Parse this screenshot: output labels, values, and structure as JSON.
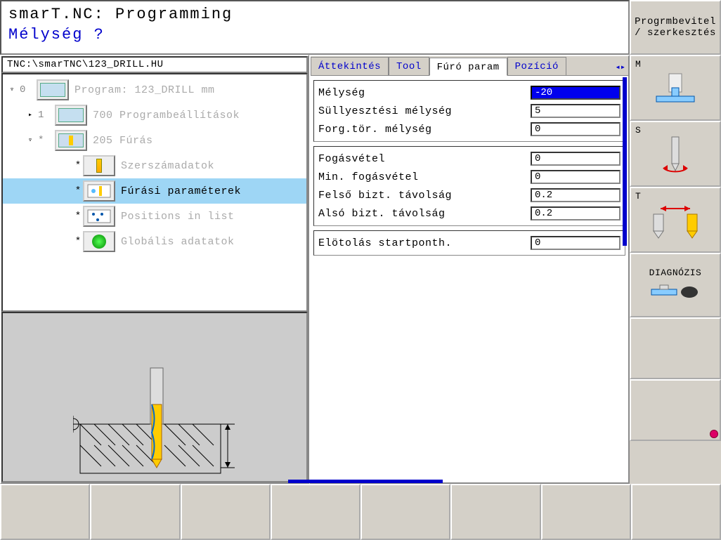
{
  "header": {
    "title": "smarT.NC: Programming",
    "prompt": "Mélység ?"
  },
  "rail_header": {
    "line1": "Progrmbevitel",
    "line2": "/ szerkesztés"
  },
  "path": "TNC:\\smarTNC\\123_DRILL.HU",
  "tree": {
    "items": [
      {
        "index": "0",
        "expander": "▿",
        "label": "Program: 123_DRILL mm",
        "dim": true,
        "indent": 0,
        "bullet": ""
      },
      {
        "index": "1",
        "expander": "▸",
        "label": "700 Programbeállítások",
        "dim": true,
        "indent": 1,
        "bullet": ""
      },
      {
        "index": "*",
        "expander": "▿",
        "label": "205 Fúrás",
        "dim": true,
        "indent": 1,
        "bullet": ""
      },
      {
        "index": "",
        "expander": "",
        "label": "Szerszámadatok",
        "dim": true,
        "indent": 2,
        "bullet": "*"
      },
      {
        "index": "",
        "expander": "",
        "label": "Fúrási paraméterek",
        "dim": false,
        "indent": 2,
        "bullet": "*",
        "selected": true
      },
      {
        "index": "",
        "expander": "",
        "label": "Positions in list",
        "dim": true,
        "indent": 2,
        "bullet": "*"
      },
      {
        "index": "",
        "expander": "",
        "label": "Globális adatatok",
        "dim": true,
        "indent": 2,
        "bullet": "*"
      }
    ]
  },
  "tabs": {
    "items": [
      {
        "label": "Áttekintés",
        "active": false
      },
      {
        "label": "Tool",
        "active": false
      },
      {
        "label": "Fúró param",
        "active": true
      },
      {
        "label": "Pozíció",
        "active": false
      }
    ]
  },
  "params": {
    "group1": [
      {
        "label": "Mélység",
        "value": "-20",
        "active": true
      },
      {
        "label": "Süllyesztési mélység",
        "value": "5",
        "active": false
      },
      {
        "label": "Forg.tör. mélység",
        "value": "0",
        "active": false
      }
    ],
    "group2": [
      {
        "label": "Fogásvétel",
        "value": "0"
      },
      {
        "label": "Min. fogásvétel",
        "value": "0"
      },
      {
        "label": "Felső bizt. távolság",
        "value": "0.2"
      },
      {
        "label": "Alsó bizt. távolság",
        "value": "0.2"
      }
    ],
    "group3": [
      {
        "label": "Elötolás startponth.",
        "value": "0"
      }
    ]
  },
  "rail": {
    "m": "M",
    "s": "S",
    "t": "T",
    "diag": "DIAGNÓZIS"
  }
}
